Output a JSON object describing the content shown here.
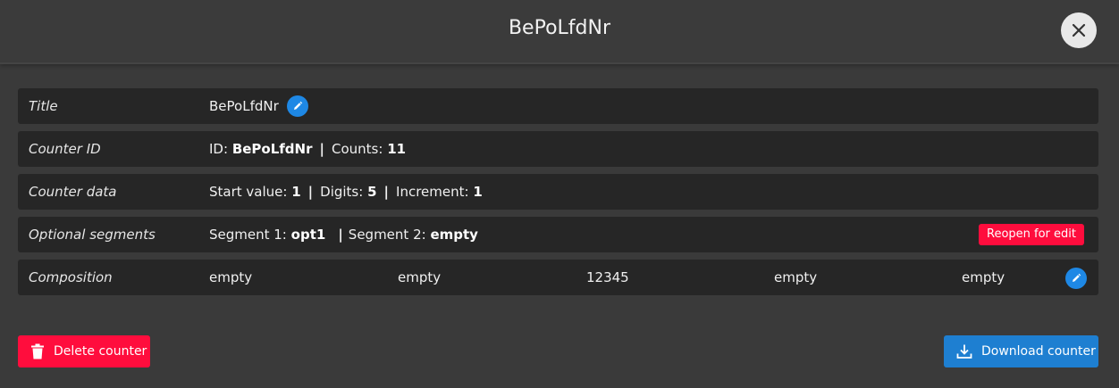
{
  "dialog": {
    "title": "BePoLfdNr"
  },
  "rows": {
    "title": {
      "label": "Title",
      "value": "BePoLfdNr"
    },
    "counter_id": {
      "label": "Counter ID",
      "id_label": "ID:",
      "id_value": "BePoLfdNr",
      "sep": "|",
      "counts_label": "Counts:",
      "counts_value": "11"
    },
    "counter_data": {
      "label": "Counter data",
      "start_label": "Start value:",
      "start_value": "1",
      "sep": "|",
      "digits_label": "Digits:",
      "digits_value": "5",
      "increment_label": "Increment:",
      "increment_value": "1"
    },
    "optional_segments": {
      "label": "Optional segments",
      "seg1_label": "Segment 1:",
      "seg1_value": "opt1",
      "sep": "|",
      "seg2_label": "Segment 2:",
      "seg2_value": "empty",
      "reopen_label": "Reopen for edit"
    },
    "composition": {
      "label": "Composition",
      "parts": [
        "empty",
        "empty",
        "12345",
        "empty",
        "empty"
      ]
    }
  },
  "actions": {
    "delete_label": "Delete counter",
    "download_label": "Download counter"
  },
  "icons": {
    "close": "close-icon",
    "edit": "pencil-icon",
    "delete": "trash-icon",
    "download": "download-icon"
  },
  "colors": {
    "background": "#3a3a3a",
    "row_background": "#262626",
    "danger": "#ff0d3d",
    "primary": "#1e7fd1",
    "edit_badge": "#1e88e5"
  }
}
